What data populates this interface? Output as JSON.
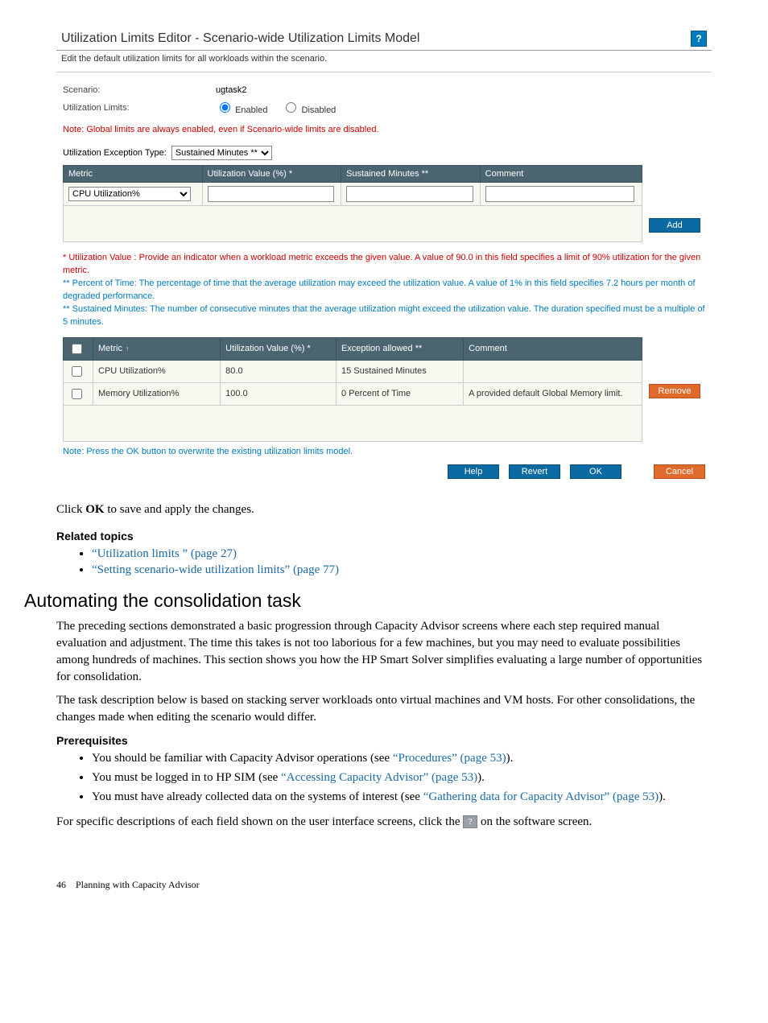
{
  "panel": {
    "title": "Utilization Limits Editor - Scenario-wide Utilization Limits Model",
    "help_corner": "?",
    "subtitle": "Edit the default utilization limits for all workloads within the scenario.",
    "scenario_label": "Scenario:",
    "scenario_value": "ugtask2",
    "limits_label": "Utilization Limits:",
    "enabled_label": "Enabled",
    "disabled_label": "Disabled",
    "note_global": "Note: Global limits are always enabled, even if Scenario-wide limits are disabled.",
    "exception_type_label": "Utilization Exception Type:",
    "exception_type_value": "Sustained Minutes **",
    "table1": {
      "h_metric": "Metric",
      "h_util": "Utilization Value (%) *",
      "h_sustained": "Sustained Minutes **",
      "h_comment": "Comment",
      "metric_value": "CPU Utilization%"
    },
    "add_label": "Add",
    "mid": {
      "l1": "* Utilization Value : Provide an indicator when a workload metric exceeds the given value. A value of 90.0 in this field specifies a limit of 90% utilization for the given metric.",
      "l2": "** Percent of Time: The percentage of time that the average utilization may exceed the utilization value. A value of 1% in this field specifies 7.2 hours per month of degraded performance.",
      "l3": "** Sustained Minutes: The number of consecutive minutes that the average utilization might exceed the utilization value. The duration specified must be a multiple of 5 minutes."
    },
    "table2": {
      "h_metric": "Metric",
      "h_util": "Utilization Value (%) *",
      "h_exc": "Exception allowed **",
      "h_comment": "Comment",
      "rows": [
        {
          "metric": "CPU Utilization%",
          "util": "80.0",
          "exc": "15 Sustained Minutes",
          "comment": ""
        },
        {
          "metric": "Memory Utilization%",
          "util": "100.0",
          "exc": "0 Percent of Time",
          "comment": "A provided default Global Memory limit."
        }
      ]
    },
    "remove_label": "Remove",
    "note_overwrite": "Note: Press the OK button to overwrite the existing utilization limits model.",
    "btn_help": "Help",
    "btn_revert": "Revert",
    "btn_ok": "OK",
    "btn_cancel": "Cancel"
  },
  "doc": {
    "click_ok_prefix": "Click ",
    "click_ok_bold": "OK",
    "click_ok_suffix": " to save and apply the changes.",
    "related_heading": "Related topics",
    "related_links": [
      "“Utilization limits ” (page 27)",
      "“Setting scenario-wide utilization limits” (page 77)"
    ],
    "section_title": "Automating the consolidation task",
    "para1": "The preceding sections demonstrated a basic progression through Capacity Advisor screens where each step required manual evaluation and adjustment. The time this takes is not too laborious for a few machines, but you may need to evaluate possibilities among hundreds of machines. This section shows you how the HP Smart Solver simplifies evaluating a large number of opportunities for consolidation.",
    "para2": "The task description below is based on stacking server workloads onto virtual machines and VM hosts. For other consolidations, the changes made when editing the scenario would differ.",
    "prereq_heading": "Prerequisites",
    "bullets": [
      {
        "pre": "You should be familiar with Capacity Advisor operations (see ",
        "link": "“Procedures” (page 53)",
        "post": ")."
      },
      {
        "pre": "You must be logged in to HP SIM (see ",
        "link": "“Accessing Capacity Advisor” (page 53)",
        "post": ")."
      },
      {
        "pre": "You must have already collected data on the systems of interest (see ",
        "link": "“Gathering data for Capacity Advisor” (page 53)",
        "post": ")."
      }
    ],
    "closing_pre": "For specific descriptions of each field shown on the user interface screens, click the ",
    "closing_badge": "?",
    "closing_post": " on the software screen.",
    "footer_page": "46",
    "footer_chapter": "Planning with Capacity Advisor"
  }
}
